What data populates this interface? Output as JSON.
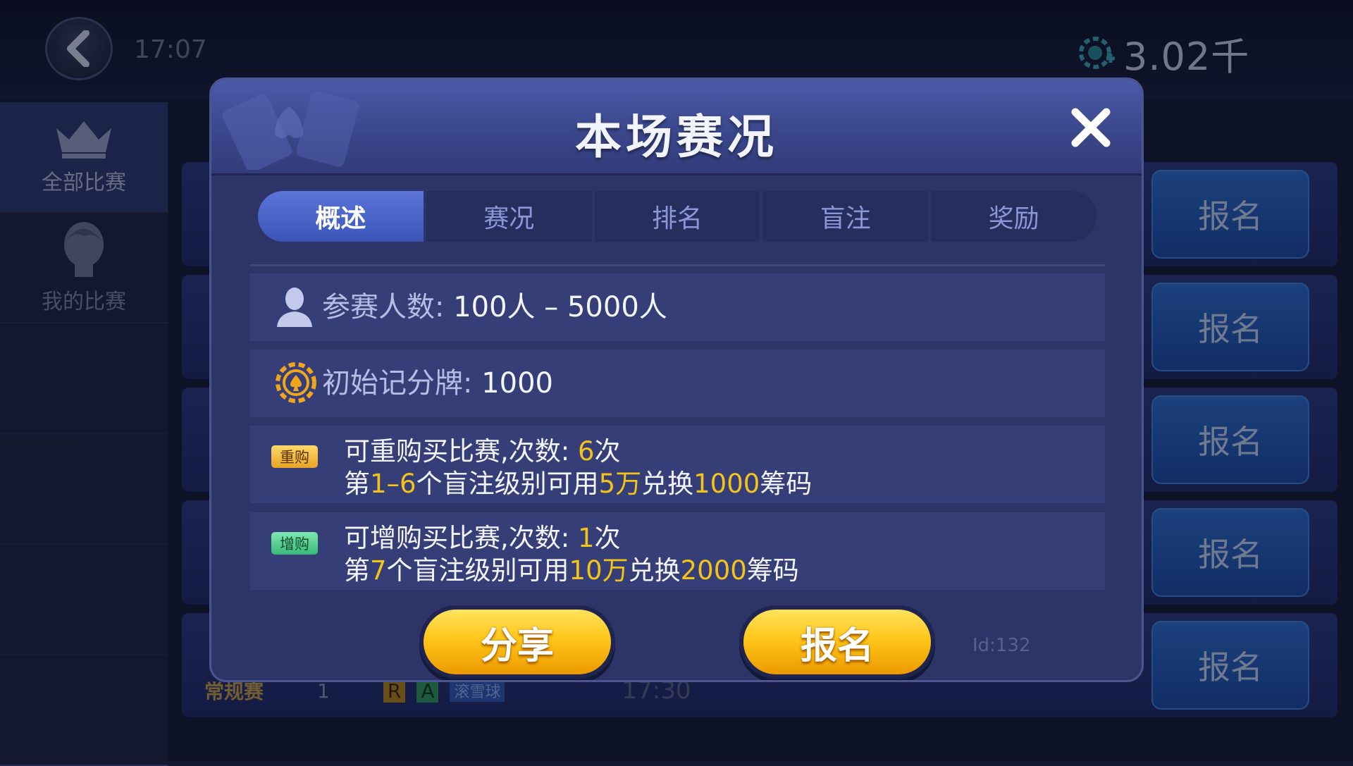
{
  "background": {
    "time": "17:07",
    "coins": "3.02千",
    "sidebar": [
      {
        "label": "全部比赛",
        "active": true
      },
      {
        "label": "我的比赛",
        "active": false
      }
    ],
    "signup_buttons": [
      "报名",
      "报名",
      "报名",
      "报名",
      "报名"
    ],
    "behind_row": {
      "players": "1",
      "tag_r": "R",
      "tag_a": "A",
      "tag_type": "滚雪球",
      "start_time": "17:30",
      "event_badge": "常规赛"
    }
  },
  "modal": {
    "title": "本场赛况",
    "tabs": [
      {
        "label": "概述",
        "active": true
      },
      {
        "label": "赛况",
        "active": false
      },
      {
        "label": "排名",
        "active": false
      },
      {
        "label": "盲注",
        "active": false
      },
      {
        "label": "奖励",
        "active": false
      }
    ],
    "players": {
      "label": "参赛人数:",
      "value": "100人 – 5000人"
    },
    "starting_chips": {
      "label": "初始记分牌:",
      "value": "1000"
    },
    "rebuy": {
      "badge": "重购",
      "l1_text": "可重购买比赛,次数:",
      "l1_count": "6",
      "l1_unit": "次",
      "l2_a": "第",
      "l2_level": "1–6",
      "l2_b": "个盲注级别可用",
      "l2_cost": "5万",
      "l2_c": "兑换",
      "l2_chips": "1000",
      "l2_d": "筹码"
    },
    "addon": {
      "badge": "增购",
      "l1_text": "可增购买比赛,次数:",
      "l1_count": "1",
      "l1_unit": "次",
      "l2_a": "第",
      "l2_level": "7",
      "l2_b": "个盲注级别可用",
      "l2_cost": "10万",
      "l2_c": "兑换",
      "l2_chips": "2000",
      "l2_d": "筹码"
    },
    "share_label": "分享",
    "signup_label": "报名",
    "id_label": "Id:132"
  }
}
